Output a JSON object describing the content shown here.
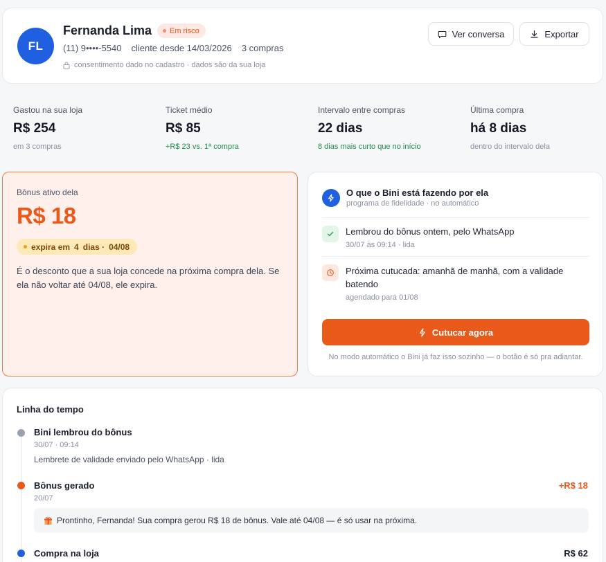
{
  "header": {
    "avatar_initials": "FL",
    "name": "Fernanda Lima",
    "risk_badge": "Em risco",
    "phone": "(11) 9••••-5540",
    "customer_since": "cliente desde 14/03/2026",
    "purchases": "3 compras",
    "consent": "consentimento dado no cadastro · dados são da sua loja",
    "btn_conversa": "Ver conversa",
    "btn_export": "Exportar"
  },
  "stats": [
    {
      "label": "Gastou na sua loja",
      "value": "R$ 254",
      "sub": "em 3 compras"
    },
    {
      "label": "Ticket médio",
      "value": "R$ 85",
      "sub": "+R$ 23 vs. 1ª compra"
    },
    {
      "label": "Intervalo entre compras",
      "value": "22 dias",
      "sub": "8 dias mais curto que no início"
    },
    {
      "label": "Última compra",
      "value": "há 8 dias",
      "sub": "dentro do intervalo dela"
    }
  ],
  "bonus": {
    "label": "Bônus ativo dela",
    "value": "R$ 18",
    "expira_prefix": "expira em",
    "expira_days": "4",
    "expira_unit": "dias ·",
    "expira_date": "04/08",
    "description": "É o desconto que a sua loja concede na próxima compra dela. Se ela não voltar até 04/08, ele expira."
  },
  "action": {
    "title": "O que o Bini está fazendo por ela",
    "subtitle": "programa de fidelidade · no automático",
    "items": [
      {
        "title": "Lembrou do bônus ontem, pelo WhatsApp",
        "sub": "30/07 às 09:14 · lida"
      },
      {
        "title": "Próxima cutucada: amanhã de manhã, com a validade batendo",
        "sub": "agendado para 01/08"
      }
    ],
    "button": "Cutucar agora",
    "note": "No modo automático o Bini já faz isso sozinho — o botão é só pra adiantar."
  },
  "timeline": {
    "title": "Linha do tempo",
    "events": [
      {
        "title": "Bini lembrou do bônus",
        "date": "30/07 · 09:14",
        "desc": "Lembrete de validade enviado pelo WhatsApp · lida"
      },
      {
        "title": "Bônus gerado",
        "date": "20/07",
        "amount": "+R$ 18",
        "message": "Prontinho, Fernanda! Sua compra gerou R$ 18 de bônus. Vale até 04/08 — é só usar na próxima."
      },
      {
        "title": "Compra na loja",
        "amount": "R$ 62"
      }
    ]
  },
  "colors": {
    "accent": "#e8591a",
    "blue": "#1f5fe0",
    "green": "#1f8a4c",
    "gray_dot": "#9aa1b2"
  }
}
